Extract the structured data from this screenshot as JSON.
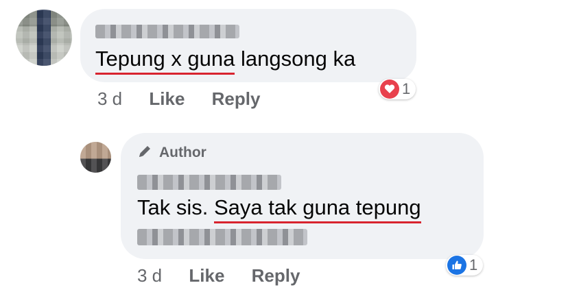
{
  "comments": [
    {
      "author_name_obscured": true,
      "text_underlined": "Tepung x guna",
      "text_rest": " langsong ka",
      "time": "3 d",
      "like_label": "Like",
      "reply_label": "Reply",
      "reaction": {
        "icon": "heart-icon",
        "count": "1",
        "color": "#e8414d"
      }
    },
    {
      "badge_label": "Author",
      "badge_icon": "pencil-icon",
      "author_name_obscured": true,
      "text_plain": "Tak sis. ",
      "text_underlined": "Saya tak guna tepung",
      "time": "3 d",
      "like_label": "Like",
      "reply_label": "Reply",
      "reaction": {
        "icon": "thumbs-up-icon",
        "count": "1",
        "color": "#1b74e4"
      }
    }
  ],
  "colors": {
    "bubble": "#f0f2f5",
    "meta_text": "#65676b",
    "underline": "#d8232e"
  }
}
